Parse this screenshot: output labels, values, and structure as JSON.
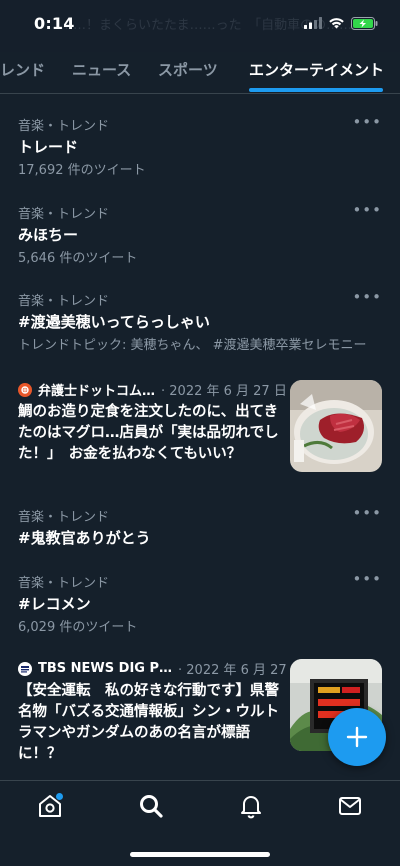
{
  "status_bar": {
    "time": "0:14"
  },
  "header": {
    "ghost_text": "……！まくらいたたま……った　「自動車のの……"
  },
  "tabs": [
    {
      "label": "レンド"
    },
    {
      "label": "ニュース"
    },
    {
      "label": "スポーツ"
    },
    {
      "label": "エンターテイメント",
      "active": true
    }
  ],
  "trends": [
    {
      "meta": "音楽・トレンド",
      "title": "トレード",
      "sub": "17,692 件のツイート"
    },
    {
      "meta": "音楽・トレンド",
      "title": "みほちー",
      "sub": "5,646 件のツイート"
    },
    {
      "meta": "音楽・トレンド",
      "title": "#渡邉美穂いってらっしゃい",
      "sub": "トレンドトピック: 美穂ちゃん、 #渡邉美穂卒業セレモニー"
    },
    {
      "meta": "音楽・トレンド",
      "title": "#鬼教官ありがとう",
      "sub": ""
    },
    {
      "meta": "音楽・トレンド",
      "title": "#レコメン",
      "sub": "6,029 件のツイート"
    }
  ],
  "news": [
    {
      "source": "弁護士ドットコム…",
      "date": "· 2022 年 6 月 27 日",
      "text": "鯛のお造り定食を注文したのに、出てきたのはマグロ…店員が「実は品切れでした！」　お金を払わなくてもいい？",
      "logo_color": "#e8572a"
    },
    {
      "source": "TBS NEWS DIG P…",
      "date": "· 2022 年 6 月 27 日",
      "text": "【安全運転　私の好きな行動です】県警名物「バズる交通情報板」シン・ウルトラマンやガンダムのあの名言が標語に！？",
      "logo_color": "#ffffff",
      "logo_text": "TBS NEWS DIG"
    }
  ],
  "more_symbol": "•••",
  "colors": {
    "accent": "#1d9bf0",
    "background": "#15202b",
    "muted": "#8b98a5"
  },
  "icons": [
    "home-icon",
    "search-icon",
    "notifications-icon",
    "messages-icon",
    "compose-plus-icon"
  ]
}
